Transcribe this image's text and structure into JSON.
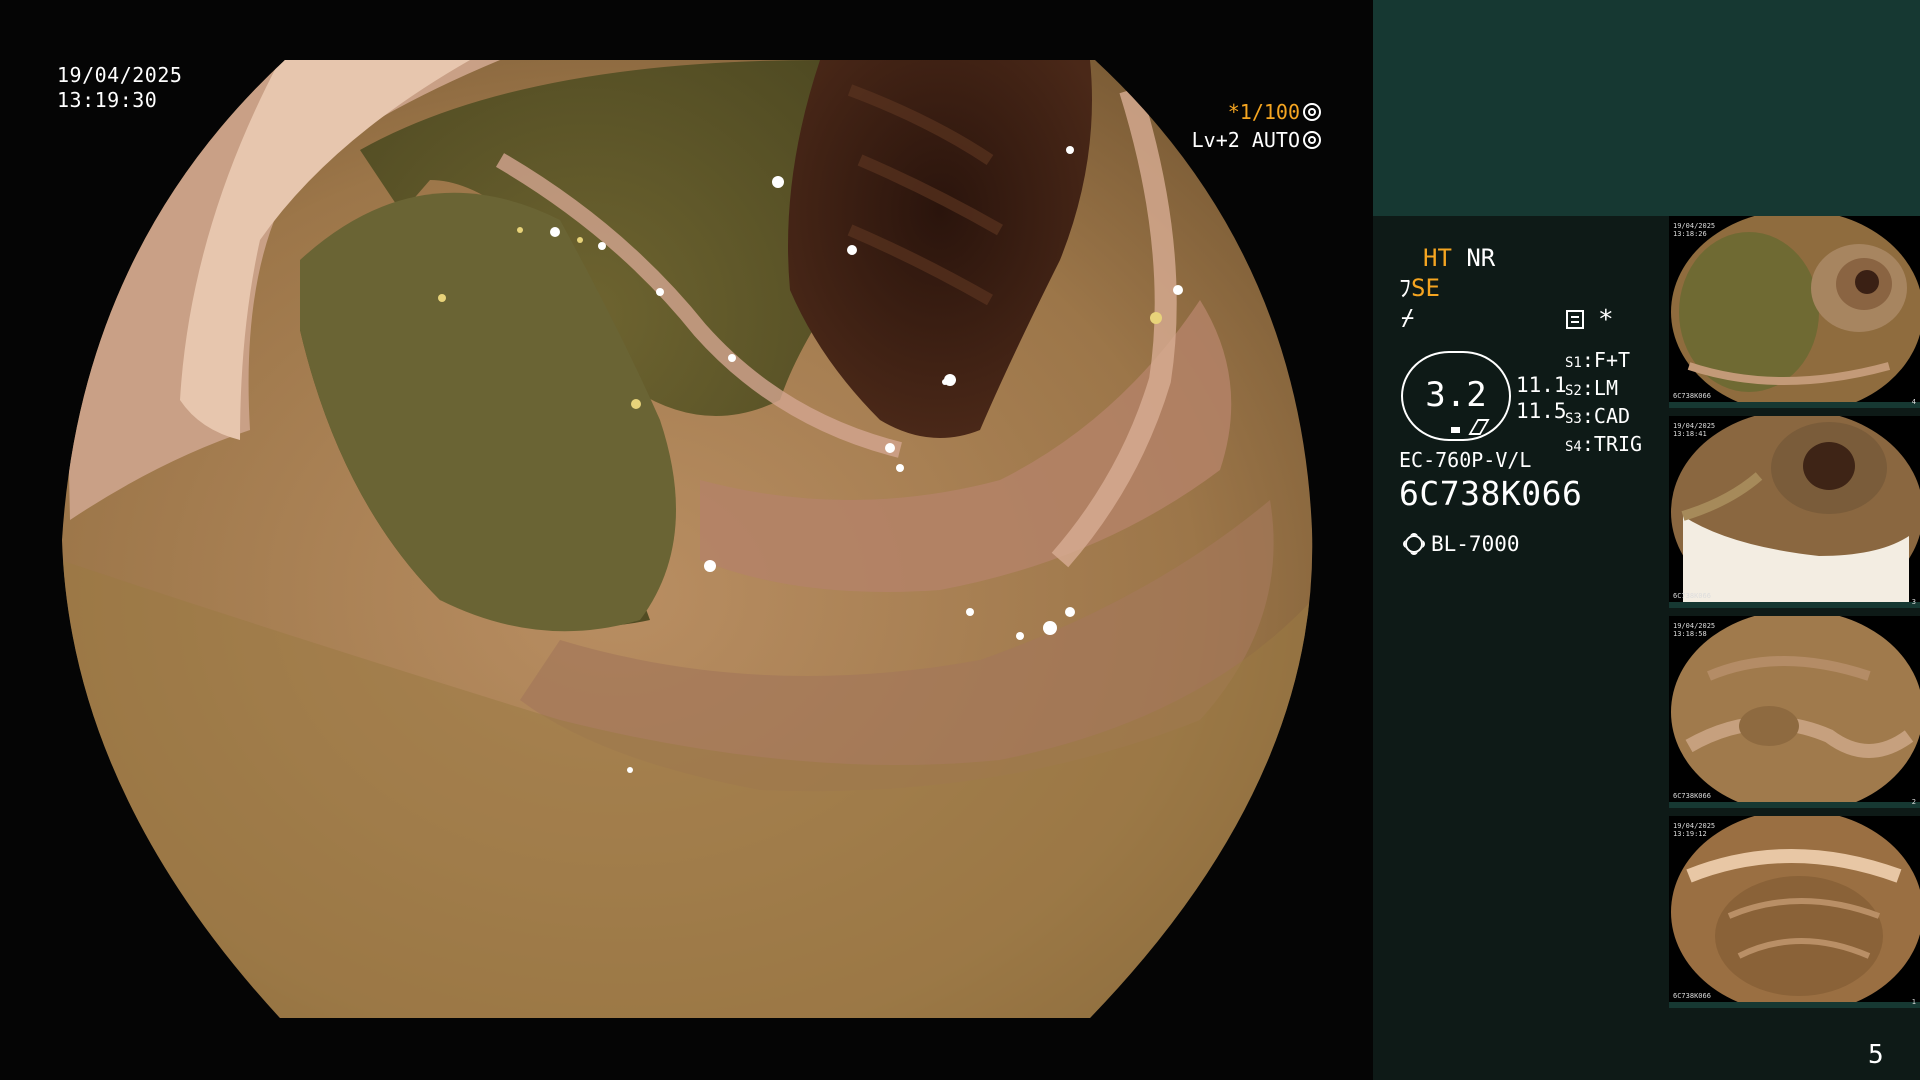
{
  "overlay": {
    "date": "19/04/2025",
    "time": "13:19:30",
    "shutter_prefix": "*",
    "shutter": "1/100",
    "iris": "Lv+2 AUTO"
  },
  "panel": {
    "mode_ht": "HT",
    "mode_nr": "NR",
    "mode_se": "SE",
    "mode_fn": "⌿",
    "star": "*",
    "gauge_value": "3.2",
    "gauge_num_1": "11.1",
    "gauge_num_2": "11.5",
    "switches": [
      {
        "key": "S1",
        "value": "F+T"
      },
      {
        "key": "S2",
        "value": "LM"
      },
      {
        "key": "S3",
        "value": "CAD"
      },
      {
        "key": "S4",
        "value": "TRIG"
      }
    ],
    "scope_model": "EC-760P-V/L",
    "scope_serial": "6C738K066",
    "light_source": "BL-7000",
    "page_number": "5"
  },
  "thumbnails": [
    {
      "date": "19/04/2025",
      "time": "13:18:26",
      "serial": "6C738K066",
      "index": "4"
    },
    {
      "date": "19/04/2025",
      "time": "13:18:41",
      "serial": "6C738K066",
      "index": "3"
    },
    {
      "date": "19/04/2025",
      "time": "13:18:58",
      "serial": "6C738K066",
      "index": "2"
    },
    {
      "date": "19/04/2025",
      "time": "13:19:12",
      "serial": "6C738K066",
      "index": "1"
    }
  ],
  "colors": {
    "accent": "#f5a521",
    "panel_top": "#163832",
    "panel_body": "#0e1a17"
  }
}
